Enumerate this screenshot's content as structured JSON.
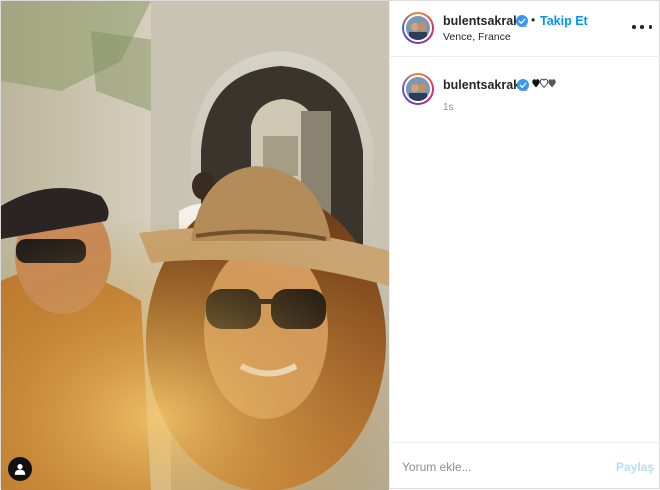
{
  "post": {
    "username": "bulentsakrak_",
    "follow_label": "Takip Et",
    "separator": "•",
    "location": "Vence, France",
    "caption_emoji": "🖤🤍🤍",
    "time_ago": "1s",
    "comment_placeholder": "Yorum ekle...",
    "share_label": "Paylaş"
  },
  "icons": {
    "verified": "verified-badge-icon",
    "more": "more-options-icon",
    "tag": "user-tag-icon",
    "hearts": "heart-emoji-icon"
  },
  "colors": {
    "accent": "#0095f6",
    "share_disabled": "#b2dffc",
    "muted": "#8e8e8e",
    "border": "#efefef"
  }
}
